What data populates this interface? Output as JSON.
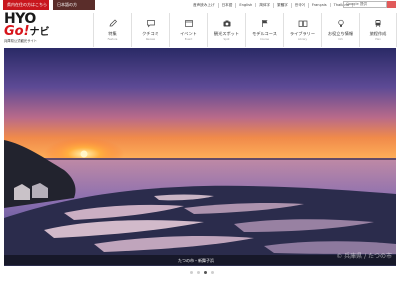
{
  "topbar": {
    "local_btn": "県内在住の方はこちら",
    "tourist_btn": "日本語の方",
    "langs": [
      "音声読み上げ",
      "日本語",
      "English",
      "简体字",
      "繁體字",
      "한국어",
      "Français",
      "Thailand"
    ],
    "search_placeholder": "Google 提供"
  },
  "logo": {
    "line1": "HYO",
    "line2_go": "Go!",
    "line2_navi": "ナビ",
    "tagline": "兵庫県公式観光サイト"
  },
  "nav": [
    {
      "label": "特集",
      "sub": "Feature",
      "icon": "pencil-icon"
    },
    {
      "label": "クチコミ",
      "sub": "Review",
      "icon": "speech-bubble-icon"
    },
    {
      "label": "イベント",
      "sub": "Event",
      "icon": "calendar-icon"
    },
    {
      "label": "観光スポット",
      "sub": "Spot",
      "icon": "camera-icon"
    },
    {
      "label": "モデルコース",
      "sub": "Course",
      "icon": "flag-icon"
    },
    {
      "label": "ライブラリー",
      "sub": "Library",
      "icon": "book-icon"
    },
    {
      "label": "お役立ち情報",
      "sub": "Info",
      "icon": "lightbulb-icon"
    },
    {
      "label": "旅程作成",
      "sub": "Plan",
      "icon": "train-icon"
    }
  ],
  "hero": {
    "caption": "たつの市・新舞子浜",
    "watermark": "© 兵庫県 / たつの市",
    "slide_count": 4,
    "active_slide": 3
  },
  "colors": {
    "brand_red": "#c8161e",
    "brand_dark": "#5a2d2a"
  }
}
